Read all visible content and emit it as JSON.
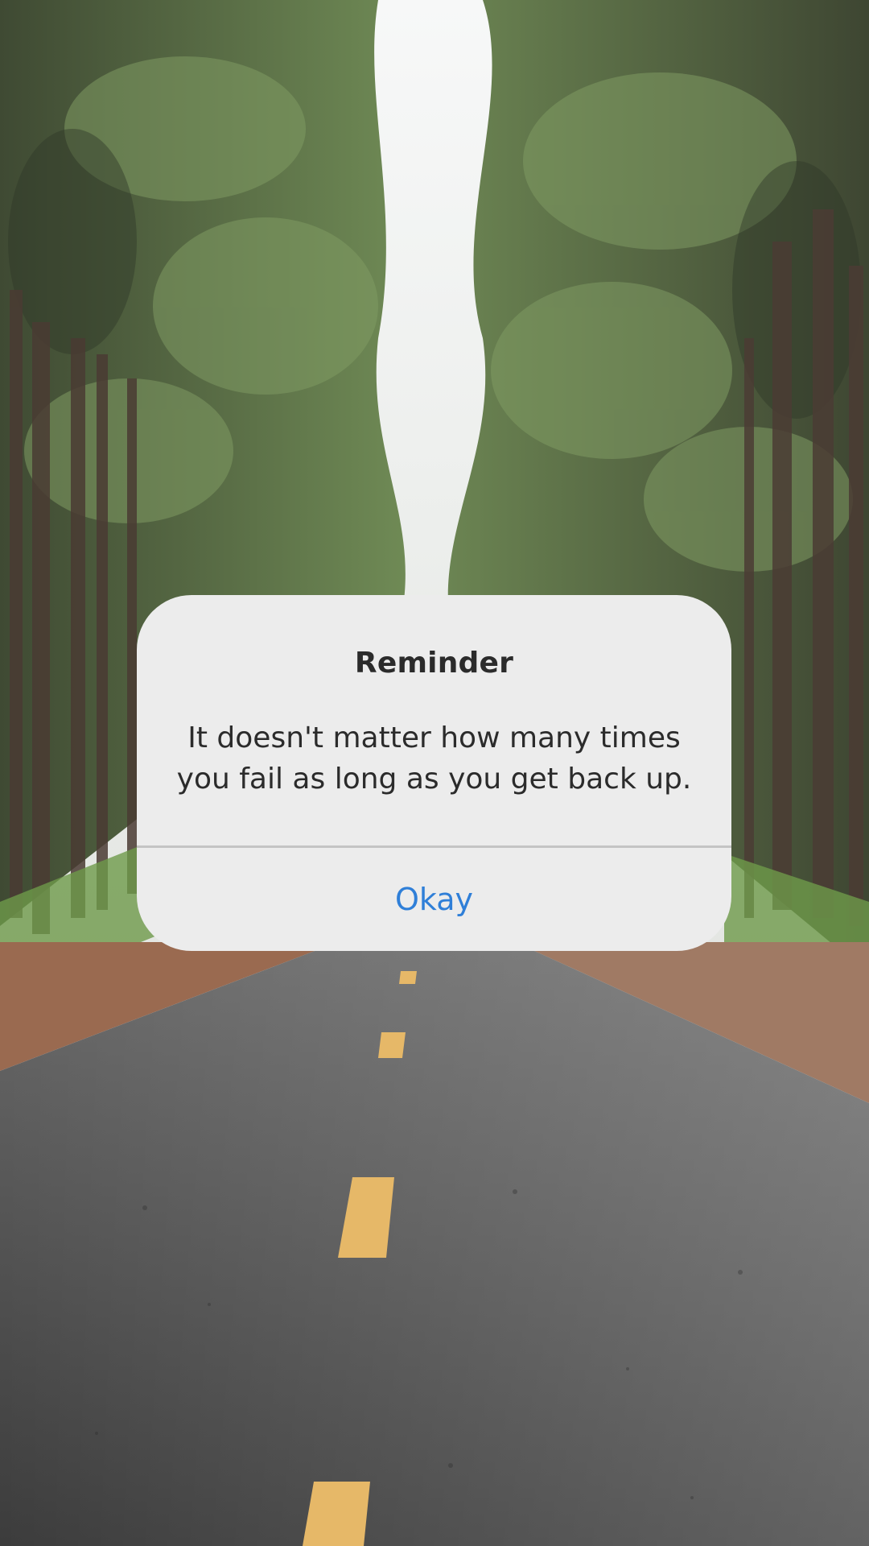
{
  "background": {
    "description_icon": "forest-road-photo",
    "sky_color": "#eef0ef",
    "foliage_color": "#5f7a4a",
    "road_color": "#4f4e4e",
    "lane_marking_color": "#e6b868"
  },
  "dialog": {
    "title": "Reminder",
    "message": "It doesn't matter how many times you fail as long as you get back up.",
    "button_label": "Okay",
    "accent_color": "#2f7fd8",
    "background_color": "#ececec"
  }
}
